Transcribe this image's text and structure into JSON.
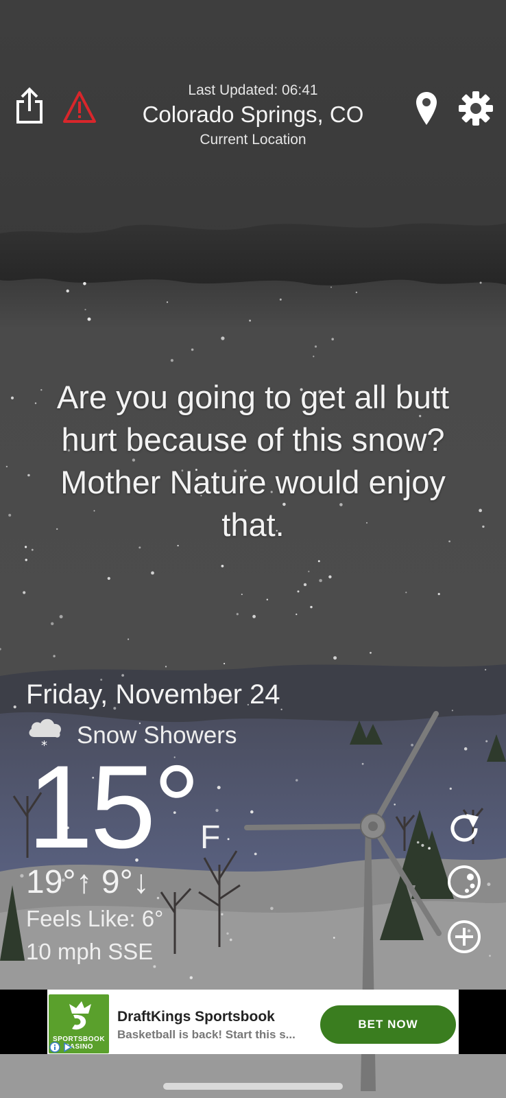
{
  "header": {
    "last_updated": "Last Updated: 06:41",
    "city": "Colorado Springs, CO",
    "location_label": "Current Location",
    "icons": [
      "share-icon",
      "alert-icon",
      "location-pin-icon",
      "gear-icon"
    ]
  },
  "quote": "Are you going to get all butt hurt because of this snow? Mother Nature would enjoy that.",
  "weather": {
    "date": "Friday, November 24",
    "condition": "Snow Showers",
    "condition_icon": "snow-cloud-icon",
    "temperature": "15°",
    "unit": "F",
    "high_low": "19°↑ 9°↓",
    "feels_like": "Feels Like: 6°",
    "wind": "10 mph SSE"
  },
  "actions": {
    "icons": [
      "refresh-icon",
      "moon-icon",
      "add-icon"
    ]
  },
  "ad": {
    "title": "DraftKings Sportsbook",
    "description": "Basketball is back! Start this s...",
    "cta": "BET NOW",
    "logo_text": "SPORTSBOOK CASINO"
  },
  "colors": {
    "sky": "#474747",
    "cloud_band": "#2b2b2b",
    "mountains": "#4e5266",
    "ground": "#8a8a8a",
    "alert_red": "#d9262b",
    "ad_green": "#3a7d1f"
  }
}
